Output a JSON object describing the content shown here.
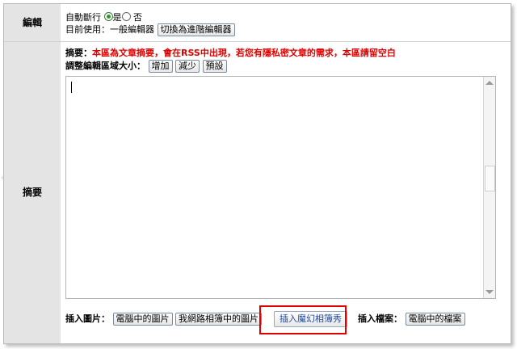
{
  "labels": {
    "edit": "編輯",
    "summary": "摘要"
  },
  "edit_section": {
    "autowrap_label": "自動斷行",
    "radio_yes": "是",
    "radio_no": "否",
    "current_editor_text": "目前使用：一般編輯器",
    "switch_button": "切換為進階編輯器"
  },
  "summary_section": {
    "note_prefix": "摘要：",
    "note_warning": "本區為文章摘要，會在RSS中出現，若您有隱私密文章的需求，本區請留空白",
    "resize_label": "調整編輯區域大小：",
    "resize_buttons": [
      "增加",
      "減少",
      "預設"
    ]
  },
  "bottom_bar": {
    "insert_image_label": "插入圖片：",
    "computer_image_button": "電腦中的圖片",
    "album_image_button": "我網路相簿中的圖片",
    "magic_album_button": "插入魔幻相簿秀",
    "insert_file_label": "插入檔案：",
    "computer_file_button": "電腦中的檔案"
  },
  "colors": {
    "warning": "#e00000",
    "label_bg": "#e4e4e4",
    "highlight": "#e00000"
  }
}
